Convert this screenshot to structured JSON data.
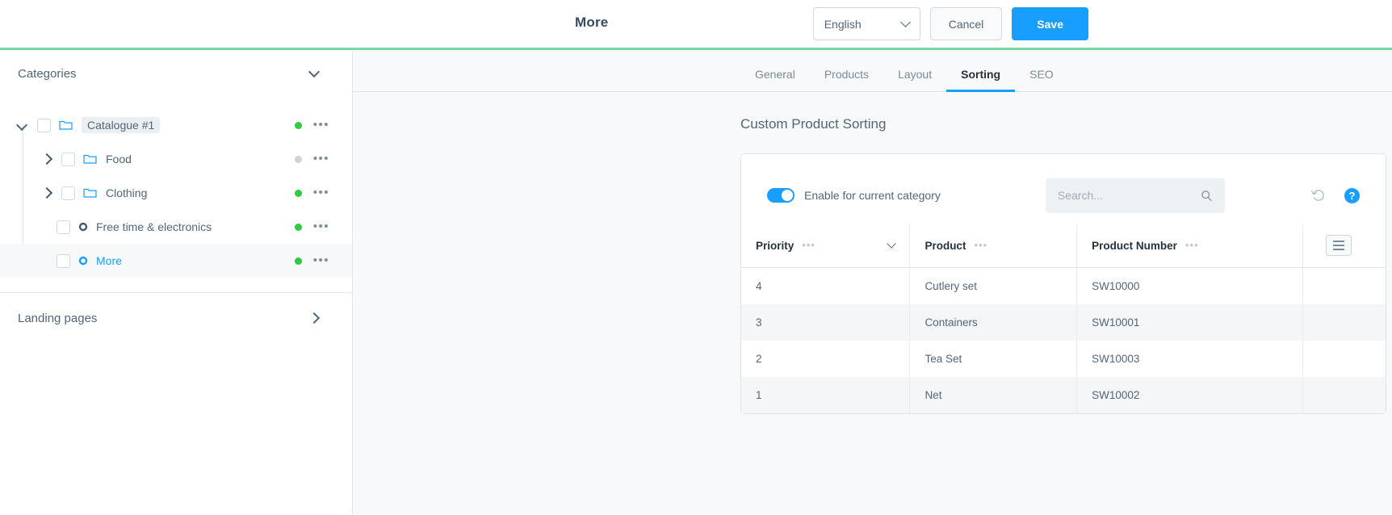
{
  "header": {
    "title": "More",
    "language_select": {
      "value": "English",
      "icon": "chevron-down-icon"
    },
    "cancel_label": "Cancel",
    "save_label": "Save",
    "accent_border": "#75d9a6",
    "save_color": "#189eff"
  },
  "sidebar": {
    "categories_label": "Categories",
    "landing_pages_label": "Landing pages",
    "tree": [
      {
        "label": "Catalogue #1",
        "depth": 0,
        "toggle": "down",
        "icon": "folder-open-icon",
        "status": "#2ecc3f",
        "selected": false,
        "chip": true,
        "menu": "more-options-icon"
      },
      {
        "label": "Food",
        "depth": 1,
        "toggle": "right",
        "icon": "folder-icon",
        "status": "#ccd4db",
        "selected": false,
        "chip": false,
        "menu": "more-options-icon"
      },
      {
        "label": "Clothing",
        "depth": 1,
        "toggle": "right",
        "icon": "folder-icon",
        "status": "#2ecc3f",
        "selected": false,
        "chip": false,
        "menu": "more-options-icon"
      },
      {
        "label": "Free time & electronics",
        "depth": 1,
        "toggle": "none",
        "icon": "circle-dot-icon",
        "status": "#2ecc3f",
        "selected": false,
        "chip": false,
        "menu": "more-options-icon"
      },
      {
        "label": "More",
        "depth": 1,
        "toggle": "none",
        "icon": "circle-dot-icon-active",
        "status": "#2ecc3f",
        "selected": true,
        "chip": false,
        "menu": "more-options-icon"
      }
    ]
  },
  "main": {
    "tabs": [
      {
        "label": "General",
        "active": false
      },
      {
        "label": "Products",
        "active": false
      },
      {
        "label": "Layout",
        "active": false
      },
      {
        "label": "Sorting",
        "active": true
      },
      {
        "label": "SEO",
        "active": false
      }
    ],
    "section_title": "Custom Product Sorting",
    "toggle": {
      "label": "Enable for current category",
      "on": true
    },
    "search": {
      "placeholder": "Search...",
      "value": "",
      "icon": "search-icon"
    },
    "reset_icon": "reset-icon",
    "help_icon": "help-icon",
    "help_glyph": "?",
    "columns_menu_icon": "hamburger-icon",
    "table": {
      "columns": [
        "Priority",
        "Product",
        "Product Number",
        ""
      ],
      "rows": [
        {
          "priority": "4",
          "product": "Cutlery set",
          "number": "SW10000"
        },
        {
          "priority": "3",
          "product": "Containers",
          "number": "SW10001"
        },
        {
          "priority": "2",
          "product": "Tea Set",
          "number": "SW10003"
        },
        {
          "priority": "1",
          "product": "Net",
          "number": "SW10002"
        }
      ]
    }
  }
}
